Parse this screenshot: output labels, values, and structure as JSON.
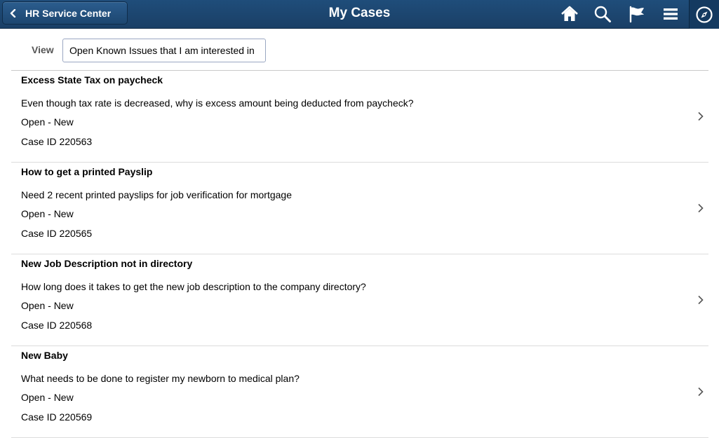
{
  "header": {
    "back_label": "HR Service Center",
    "title": "My Cases",
    "icons": [
      "home-icon",
      "search-icon",
      "flag-icon",
      "menu-icon",
      "navigator-icon"
    ]
  },
  "view": {
    "label": "View",
    "selected": "Open Known Issues that I am interested in"
  },
  "cases": [
    {
      "title": "Excess State Tax on paycheck",
      "description": "Even though tax rate is decreased, why is excess amount being deducted from paycheck?",
      "status": "Open - New",
      "case_id": "Case ID 220563"
    },
    {
      "title": "How to get a printed Payslip",
      "description": "Need 2 recent printed payslips for job verification for mortgage",
      "status": "Open - New",
      "case_id": "Case ID 220565"
    },
    {
      "title": "New Job Description not in directory",
      "description": "How long does it takes to get the new job description to the company directory?",
      "status": "Open - New",
      "case_id": "Case ID 220568"
    },
    {
      "title": "New Baby",
      "description": "What needs to be done to register my newborn to medical plan?",
      "status": "Open - New",
      "case_id": "Case ID 220569"
    }
  ]
}
